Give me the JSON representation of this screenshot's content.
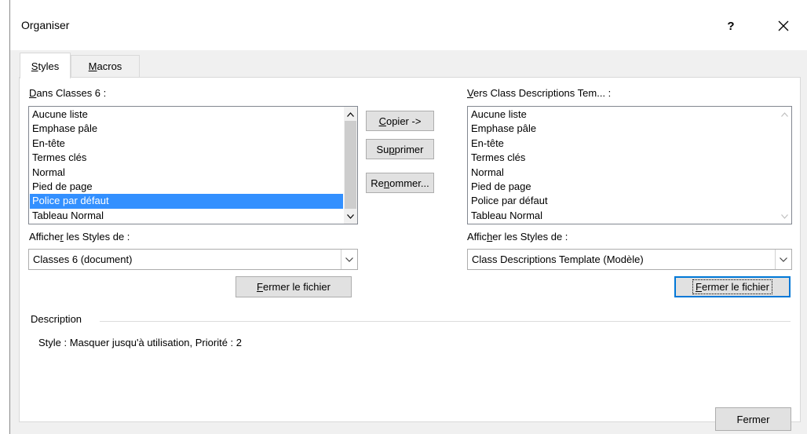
{
  "dialog": {
    "title": "Organiser",
    "help_label": "?",
    "close_icon": "close-icon"
  },
  "tabs": [
    {
      "pre": "",
      "acc": "S",
      "post": "tyles",
      "active": true
    },
    {
      "pre": "",
      "acc": "M",
      "post": "acros",
      "active": false
    }
  ],
  "left": {
    "list_label_acc": "D",
    "list_label_rest": "ans Classes 6 :",
    "items": [
      "Aucune liste",
      "Emphase pâle",
      "En-tête",
      "Termes clés",
      "Normal",
      "Pied de page",
      "Police par défaut",
      "Tableau Normal"
    ],
    "selected_index": 6,
    "show_label_pre": "Affiche",
    "show_label_acc": "r",
    "show_label_post": " les Styles de :",
    "combo_value": "Classes 6 (document)",
    "close_file_acc": "F",
    "close_file_rest": "ermer le fichier"
  },
  "right": {
    "list_label_acc": "V",
    "list_label_rest": "ers Class Descriptions Tem... :",
    "items": [
      "Aucune liste",
      "Emphase pâle",
      "En-tête",
      "Termes clés",
      "Normal",
      "Pied de page",
      "Police par défaut",
      "Tableau Normal"
    ],
    "show_label_pre": "Affic",
    "show_label_acc": "h",
    "show_label_post": "er les Styles de :",
    "combo_value": "Class Descriptions Template (Modèle)",
    "close_file_acc": "F",
    "close_file_rest": "ermer le fichier"
  },
  "actions": {
    "copy_acc": "C",
    "copy_rest": "opier ->",
    "delete_pre": "Su",
    "delete_acc": "p",
    "delete_post": "primer",
    "rename_pre": "Re",
    "rename_acc": "n",
    "rename_post": "ommer..."
  },
  "description": {
    "heading": "Description",
    "text": "Style : Masquer jusqu'à utilisation, Priorité : 2"
  },
  "footer": {
    "close_label": "Fermer"
  }
}
